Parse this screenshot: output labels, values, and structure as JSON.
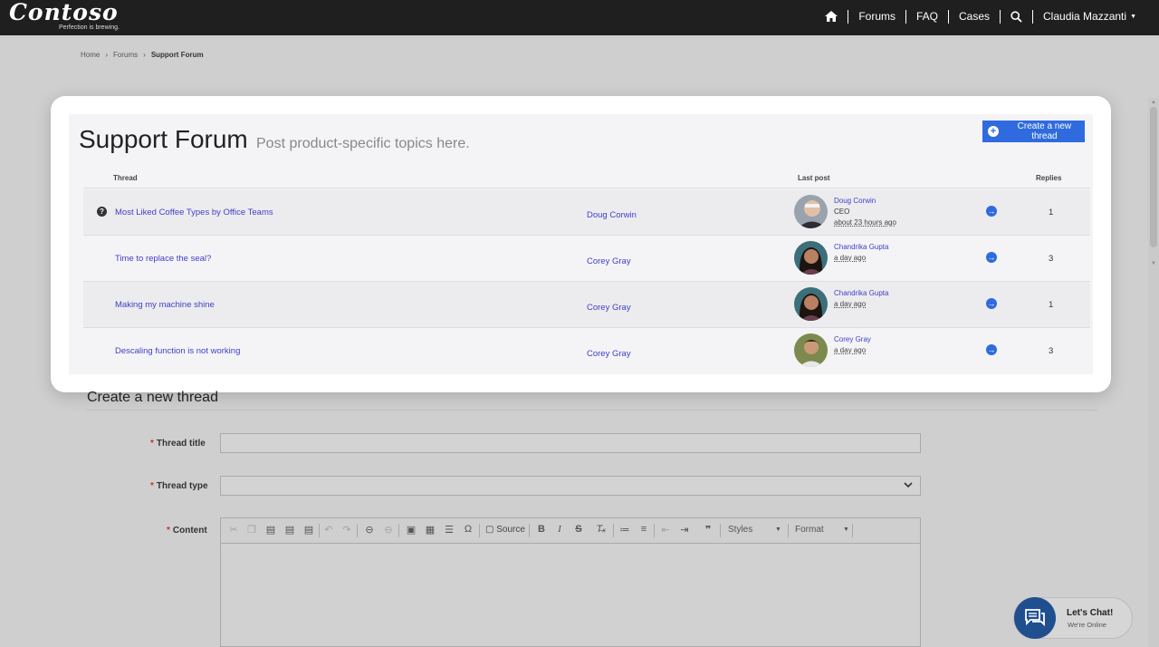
{
  "brand": {
    "name": "Contoso",
    "tagline": "Perfection is brewing."
  },
  "nav": {
    "forums": "Forums",
    "faq": "FAQ",
    "cases": "Cases",
    "user": "Claudia Mazzanti"
  },
  "breadcrumb": {
    "home": "Home",
    "forums": "Forums",
    "current": "Support Forum"
  },
  "forum": {
    "title": "Support Forum",
    "subtitle": "Post product-specific topics here.",
    "new_thread_label": "Create a new thread",
    "columns": {
      "thread": "Thread",
      "last_post": "Last post",
      "replies": "Replies"
    },
    "threads": [
      {
        "title": "Most Liked Coffee Types by Office Teams",
        "author": "Doug Corwin",
        "last_post_name": "Doug Corwin",
        "last_post_role": "CEO",
        "last_post_time": "about 23 hours ago",
        "replies": "1"
      },
      {
        "title": "Time to replace the seal?",
        "author": "Corey Gray",
        "last_post_name": "Chandrika Gupta",
        "last_post_role": "",
        "last_post_time": "a day ago",
        "replies": "3"
      },
      {
        "title": "Making my machine shine",
        "author": "Corey Gray",
        "last_post_name": "Chandrika Gupta",
        "last_post_role": "",
        "last_post_time": "a day ago",
        "replies": "1"
      },
      {
        "title": "Descaling function is not working",
        "author": "Corey Gray",
        "last_post_name": "Corey Gray",
        "last_post_role": "",
        "last_post_time": "a day ago",
        "replies": "3"
      }
    ]
  },
  "form": {
    "title": "Create a new thread",
    "required_mark": "*",
    "thread_title_label": "Thread title",
    "thread_type_label": "Thread type",
    "content_label": "Content",
    "toolbar": {
      "source": "Source",
      "styles": "Styles",
      "format": "Format"
    }
  },
  "chat": {
    "title": "Let's Chat!",
    "status": "We're Online"
  },
  "colors": {
    "accent": "#2f6bde",
    "link": "#3f3fc8",
    "topbar": "#1f1f1f",
    "chat": "#1f4f8f"
  }
}
